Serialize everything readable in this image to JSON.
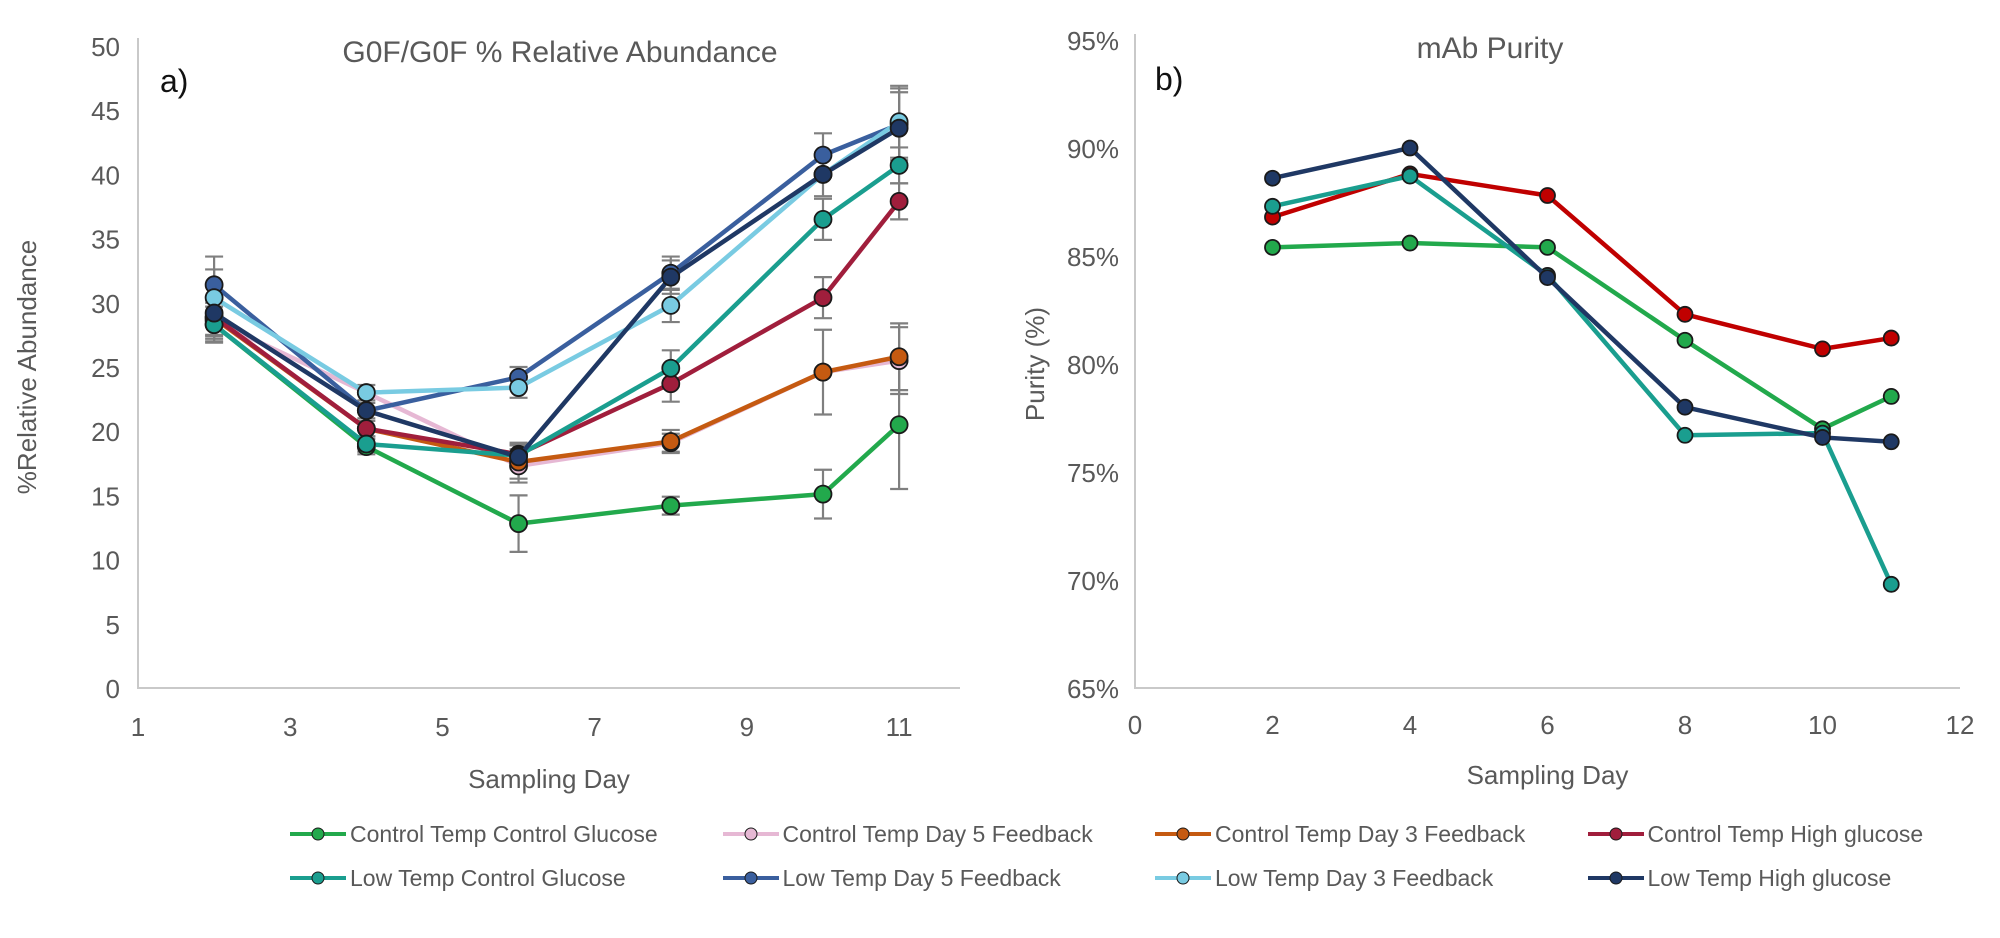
{
  "figure": {
    "background": "#ffffff",
    "text_color": "#595959"
  },
  "panel_a": {
    "letter": "a)",
    "title": "G0F/G0F % Relative Abundance",
    "xlabel": "Sampling Day",
    "ylabel": "%Relative Abundance",
    "xticks": [
      "1",
      "3",
      "5",
      "7",
      "9",
      "11"
    ],
    "yticks": [
      "0",
      "5",
      "10",
      "15",
      "20",
      "25",
      "30",
      "35",
      "40",
      "45",
      "50"
    ]
  },
  "panel_b": {
    "letter": "b)",
    "title": "mAb Purity",
    "xlabel": "Sampling Day",
    "ylabel": "Purity (%)",
    "xticks": [
      "0",
      "2",
      "4",
      "6",
      "8",
      "10",
      "12"
    ],
    "yticks": [
      "65%",
      "70%",
      "75%",
      "80%",
      "85%",
      "90%",
      "95%"
    ]
  },
  "legend": {
    "items": [
      {
        "label": "Control Temp Control Glucose",
        "color": "#22a94c"
      },
      {
        "label": "Control Temp Day 5 Feedback",
        "color": "#e6b8d4"
      },
      {
        "label": "Control Temp Day 3 Feedback",
        "color": "#c55a11"
      },
      {
        "label": "Control Temp High glucose",
        "color": "#a01e3c"
      },
      {
        "label": "Low Temp Control Glucose",
        "color": "#1a9e8f"
      },
      {
        "label": "Low Temp Day 5 Feedback",
        "color": "#3a5f9e"
      },
      {
        "label": "Low Temp Day 3 Feedback",
        "color": "#79cbe2"
      },
      {
        "label": "Low Temp High glucose",
        "color": "#1f3864"
      }
    ]
  },
  "chart_data": [
    {
      "type": "line",
      "panel": "a",
      "title": "G0F/G0F % Relative Abundance",
      "xlabel": "Sampling Day",
      "ylabel": "%Relative Abundance",
      "xlim": [
        1,
        11.8
      ],
      "ylim": [
        0,
        50
      ],
      "xticks": [
        1,
        3,
        5,
        7,
        9,
        11
      ],
      "yticks": [
        0,
        5,
        10,
        15,
        20,
        25,
        30,
        35,
        40,
        45,
        50
      ],
      "grid": false,
      "x": [
        2,
        4,
        6,
        8,
        10,
        11
      ],
      "errorbars": true,
      "series": [
        {
          "name": "Control Temp Control Glucose",
          "color": "#22a94c",
          "values": [
            28.3,
            18.8,
            12.8,
            14.2,
            15.1,
            20.5
          ],
          "errors": [
            1.4,
            0.6,
            2.2,
            0.7,
            1.9,
            5.0
          ]
        },
        {
          "name": "Control Temp Day 5 Feedback",
          "color": "#e6b8d4",
          "values": [
            28.6,
            23.0,
            17.3,
            19.1,
            24.6,
            25.5
          ],
          "errors": [
            1.4,
            0.6,
            1.3,
            0.7,
            3.3,
            2.6
          ]
        },
        {
          "name": "Control Temp Day 3 Feedback",
          "color": "#c55a11",
          "values": [
            28.8,
            20.2,
            17.6,
            19.2,
            24.6,
            25.8
          ],
          "errors": [
            1.4,
            0.6,
            1.3,
            0.9,
            3.3,
            2.6
          ]
        },
        {
          "name": "Control Temp High glucose",
          "color": "#a01e3c",
          "values": [
            28.9,
            20.2,
            18.2,
            23.7,
            30.4,
            37.9
          ],
          "errors": [
            1.4,
            0.6,
            0.9,
            1.4,
            1.6,
            1.4
          ]
        },
        {
          "name": "Low Temp Control Glucose",
          "color": "#1a9e8f",
          "values": [
            28.3,
            19.0,
            18.1,
            24.9,
            36.5,
            40.7
          ],
          "errors": [
            1.4,
            0.6,
            0.9,
            1.4,
            1.6,
            1.4
          ]
        },
        {
          "name": "Low Temp Day 5 Feedback",
          "color": "#3a5f9e",
          "values": [
            31.4,
            21.6,
            24.2,
            32.3,
            41.5,
            43.9
          ],
          "errors": [
            2.2,
            0.6,
            0.8,
            1.3,
            1.7,
            2.8
          ]
        },
        {
          "name": "Low Temp Day 3 Feedback",
          "color": "#79cbe2",
          "values": [
            30.4,
            23.0,
            23.4,
            29.8,
            40.0,
            44.1
          ],
          "errors": [
            2.2,
            0.6,
            0.8,
            1.3,
            1.7,
            2.8
          ]
        },
        {
          "name": "Low Temp High glucose",
          "color": "#1f3864",
          "values": [
            29.2,
            21.6,
            18.0,
            32.0,
            40.0,
            43.6
          ],
          "errors": [
            2.2,
            0.6,
            0.9,
            1.3,
            1.7,
            2.8
          ]
        }
      ]
    },
    {
      "type": "line",
      "panel": "b",
      "title": "mAb Purity",
      "xlabel": "Sampling Day",
      "ylabel": "Purity (%)",
      "xlim": [
        0,
        12
      ],
      "ylim": [
        65,
        95
      ],
      "xticks": [
        0,
        2,
        4,
        6,
        8,
        10,
        12
      ],
      "yticks": [
        65,
        70,
        75,
        80,
        85,
        90,
        95
      ],
      "ytick_labels": [
        "65%",
        "70%",
        "75%",
        "80%",
        "85%",
        "90%",
        "95%"
      ],
      "grid": false,
      "x": [
        2,
        4,
        6,
        8,
        10,
        11
      ],
      "errorbars": false,
      "series": [
        {
          "name": "Control Temp Control Glucose",
          "color": "#22a94c",
          "values": [
            85.4,
            85.6,
            85.4,
            81.1,
            77.0,
            78.5
          ]
        },
        {
          "name": "Control Temp High glucose",
          "color": "#c00000",
          "values": [
            86.8,
            88.8,
            87.8,
            82.3,
            80.7,
            81.2
          ]
        },
        {
          "name": "Low Temp Control Glucose",
          "color": "#1a9e8f",
          "values": [
            87.3,
            88.7,
            84.1,
            76.7,
            76.8,
            69.8
          ]
        },
        {
          "name": "Low Temp High glucose",
          "color": "#1f3864",
          "values": [
            88.6,
            90.0,
            84.0,
            78.0,
            76.6,
            76.4
          ]
        }
      ]
    }
  ]
}
